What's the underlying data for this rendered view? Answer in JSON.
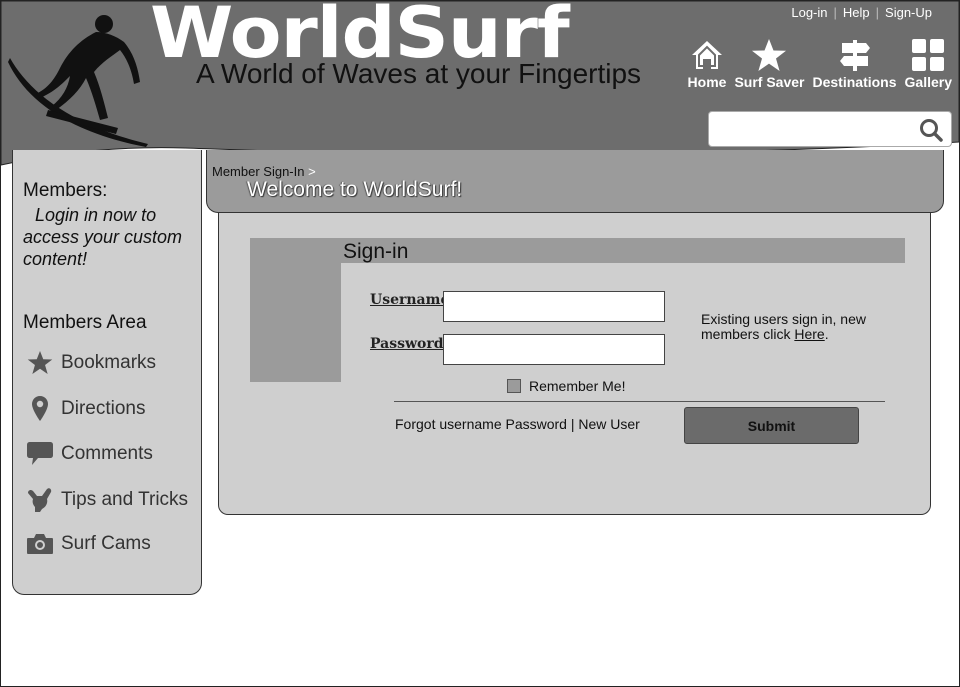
{
  "header": {
    "logo": "WorldSurf",
    "tagline": "A World of Waves at your Fingertips",
    "top_links": [
      "Log-in",
      "Help",
      "Sign-Up"
    ],
    "nav": [
      {
        "label": "Home",
        "icon": "home-icon"
      },
      {
        "label": "Surf Saver",
        "icon": "star-icon"
      },
      {
        "label": "Destinations",
        "icon": "signpost-icon"
      },
      {
        "label": "Gallery",
        "icon": "grid-icon"
      }
    ],
    "search": {
      "placeholder": "",
      "value": "",
      "icon": "search-icon"
    },
    "colors": {
      "header_bg": "#6d6d6d",
      "accent_gray": "#9b9b9b",
      "panel_gray": "#cfcfcf"
    }
  },
  "sidebar": {
    "members_title": "Members:",
    "members_msg": "Login in now to access your custom content!",
    "members_area_title": "Members Area",
    "items": [
      {
        "label": "Bookmarks",
        "icon": "star-icon"
      },
      {
        "label": "Directions",
        "icon": "map-pin-icon"
      },
      {
        "label": "Comments",
        "icon": "speech-bubble-icon"
      },
      {
        "label": "Tips and Tricks",
        "icon": "shaka-hand-icon"
      },
      {
        "label": "Surf Cams",
        "icon": "camera-icon"
      }
    ]
  },
  "main": {
    "breadcrumb": "Member Sign-In",
    "breadcrumb_sep": ">",
    "page_title": "Welcome to WorldSurf!",
    "signin": {
      "title": "Sign-in",
      "username_label": "Username",
      "password_label": "Password",
      "username_value": "",
      "password_value": "",
      "remember_label": "Remember Me!",
      "remember_checked": false,
      "info_text": "Existing users sign in, new members click ",
      "info_link": "Here",
      "info_end": ".",
      "forgot_username": "Forgot username",
      "forgot_password": "Password",
      "forgot_sep": "|",
      "new_user": "New User",
      "submit_label": "Submit"
    }
  }
}
